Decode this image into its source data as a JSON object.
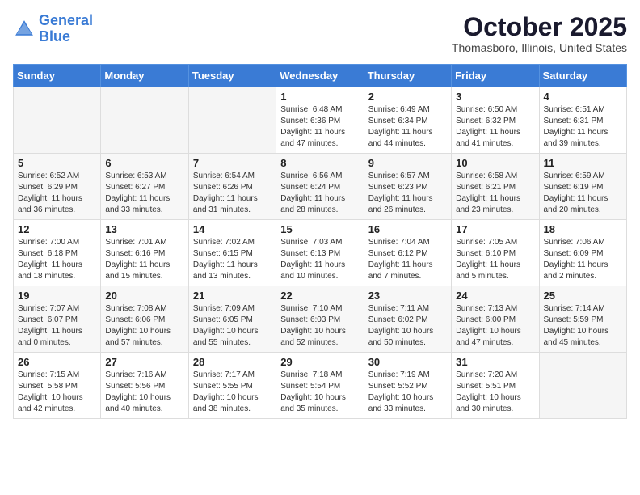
{
  "header": {
    "logo_line1": "General",
    "logo_line2": "Blue",
    "month_title": "October 2025",
    "location": "Thomasboro, Illinois, United States"
  },
  "weekdays": [
    "Sunday",
    "Monday",
    "Tuesday",
    "Wednesday",
    "Thursday",
    "Friday",
    "Saturday"
  ],
  "weeks": [
    [
      {
        "day": "",
        "info": ""
      },
      {
        "day": "",
        "info": ""
      },
      {
        "day": "",
        "info": ""
      },
      {
        "day": "1",
        "info": "Sunrise: 6:48 AM\nSunset: 6:36 PM\nDaylight: 11 hours\nand 47 minutes."
      },
      {
        "day": "2",
        "info": "Sunrise: 6:49 AM\nSunset: 6:34 PM\nDaylight: 11 hours\nand 44 minutes."
      },
      {
        "day": "3",
        "info": "Sunrise: 6:50 AM\nSunset: 6:32 PM\nDaylight: 11 hours\nand 41 minutes."
      },
      {
        "day": "4",
        "info": "Sunrise: 6:51 AM\nSunset: 6:31 PM\nDaylight: 11 hours\nand 39 minutes."
      }
    ],
    [
      {
        "day": "5",
        "info": "Sunrise: 6:52 AM\nSunset: 6:29 PM\nDaylight: 11 hours\nand 36 minutes."
      },
      {
        "day": "6",
        "info": "Sunrise: 6:53 AM\nSunset: 6:27 PM\nDaylight: 11 hours\nand 33 minutes."
      },
      {
        "day": "7",
        "info": "Sunrise: 6:54 AM\nSunset: 6:26 PM\nDaylight: 11 hours\nand 31 minutes."
      },
      {
        "day": "8",
        "info": "Sunrise: 6:56 AM\nSunset: 6:24 PM\nDaylight: 11 hours\nand 28 minutes."
      },
      {
        "day": "9",
        "info": "Sunrise: 6:57 AM\nSunset: 6:23 PM\nDaylight: 11 hours\nand 26 minutes."
      },
      {
        "day": "10",
        "info": "Sunrise: 6:58 AM\nSunset: 6:21 PM\nDaylight: 11 hours\nand 23 minutes."
      },
      {
        "day": "11",
        "info": "Sunrise: 6:59 AM\nSunset: 6:19 PM\nDaylight: 11 hours\nand 20 minutes."
      }
    ],
    [
      {
        "day": "12",
        "info": "Sunrise: 7:00 AM\nSunset: 6:18 PM\nDaylight: 11 hours\nand 18 minutes."
      },
      {
        "day": "13",
        "info": "Sunrise: 7:01 AM\nSunset: 6:16 PM\nDaylight: 11 hours\nand 15 minutes."
      },
      {
        "day": "14",
        "info": "Sunrise: 7:02 AM\nSunset: 6:15 PM\nDaylight: 11 hours\nand 13 minutes."
      },
      {
        "day": "15",
        "info": "Sunrise: 7:03 AM\nSunset: 6:13 PM\nDaylight: 11 hours\nand 10 minutes."
      },
      {
        "day": "16",
        "info": "Sunrise: 7:04 AM\nSunset: 6:12 PM\nDaylight: 11 hours\nand 7 minutes."
      },
      {
        "day": "17",
        "info": "Sunrise: 7:05 AM\nSunset: 6:10 PM\nDaylight: 11 hours\nand 5 minutes."
      },
      {
        "day": "18",
        "info": "Sunrise: 7:06 AM\nSunset: 6:09 PM\nDaylight: 11 hours\nand 2 minutes."
      }
    ],
    [
      {
        "day": "19",
        "info": "Sunrise: 7:07 AM\nSunset: 6:07 PM\nDaylight: 11 hours\nand 0 minutes."
      },
      {
        "day": "20",
        "info": "Sunrise: 7:08 AM\nSunset: 6:06 PM\nDaylight: 10 hours\nand 57 minutes."
      },
      {
        "day": "21",
        "info": "Sunrise: 7:09 AM\nSunset: 6:05 PM\nDaylight: 10 hours\nand 55 minutes."
      },
      {
        "day": "22",
        "info": "Sunrise: 7:10 AM\nSunset: 6:03 PM\nDaylight: 10 hours\nand 52 minutes."
      },
      {
        "day": "23",
        "info": "Sunrise: 7:11 AM\nSunset: 6:02 PM\nDaylight: 10 hours\nand 50 minutes."
      },
      {
        "day": "24",
        "info": "Sunrise: 7:13 AM\nSunset: 6:00 PM\nDaylight: 10 hours\nand 47 minutes."
      },
      {
        "day": "25",
        "info": "Sunrise: 7:14 AM\nSunset: 5:59 PM\nDaylight: 10 hours\nand 45 minutes."
      }
    ],
    [
      {
        "day": "26",
        "info": "Sunrise: 7:15 AM\nSunset: 5:58 PM\nDaylight: 10 hours\nand 42 minutes."
      },
      {
        "day": "27",
        "info": "Sunrise: 7:16 AM\nSunset: 5:56 PM\nDaylight: 10 hours\nand 40 minutes."
      },
      {
        "day": "28",
        "info": "Sunrise: 7:17 AM\nSunset: 5:55 PM\nDaylight: 10 hours\nand 38 minutes."
      },
      {
        "day": "29",
        "info": "Sunrise: 7:18 AM\nSunset: 5:54 PM\nDaylight: 10 hours\nand 35 minutes."
      },
      {
        "day": "30",
        "info": "Sunrise: 7:19 AM\nSunset: 5:52 PM\nDaylight: 10 hours\nand 33 minutes."
      },
      {
        "day": "31",
        "info": "Sunrise: 7:20 AM\nSunset: 5:51 PM\nDaylight: 10 hours\nand 30 minutes."
      },
      {
        "day": "",
        "info": ""
      }
    ]
  ]
}
